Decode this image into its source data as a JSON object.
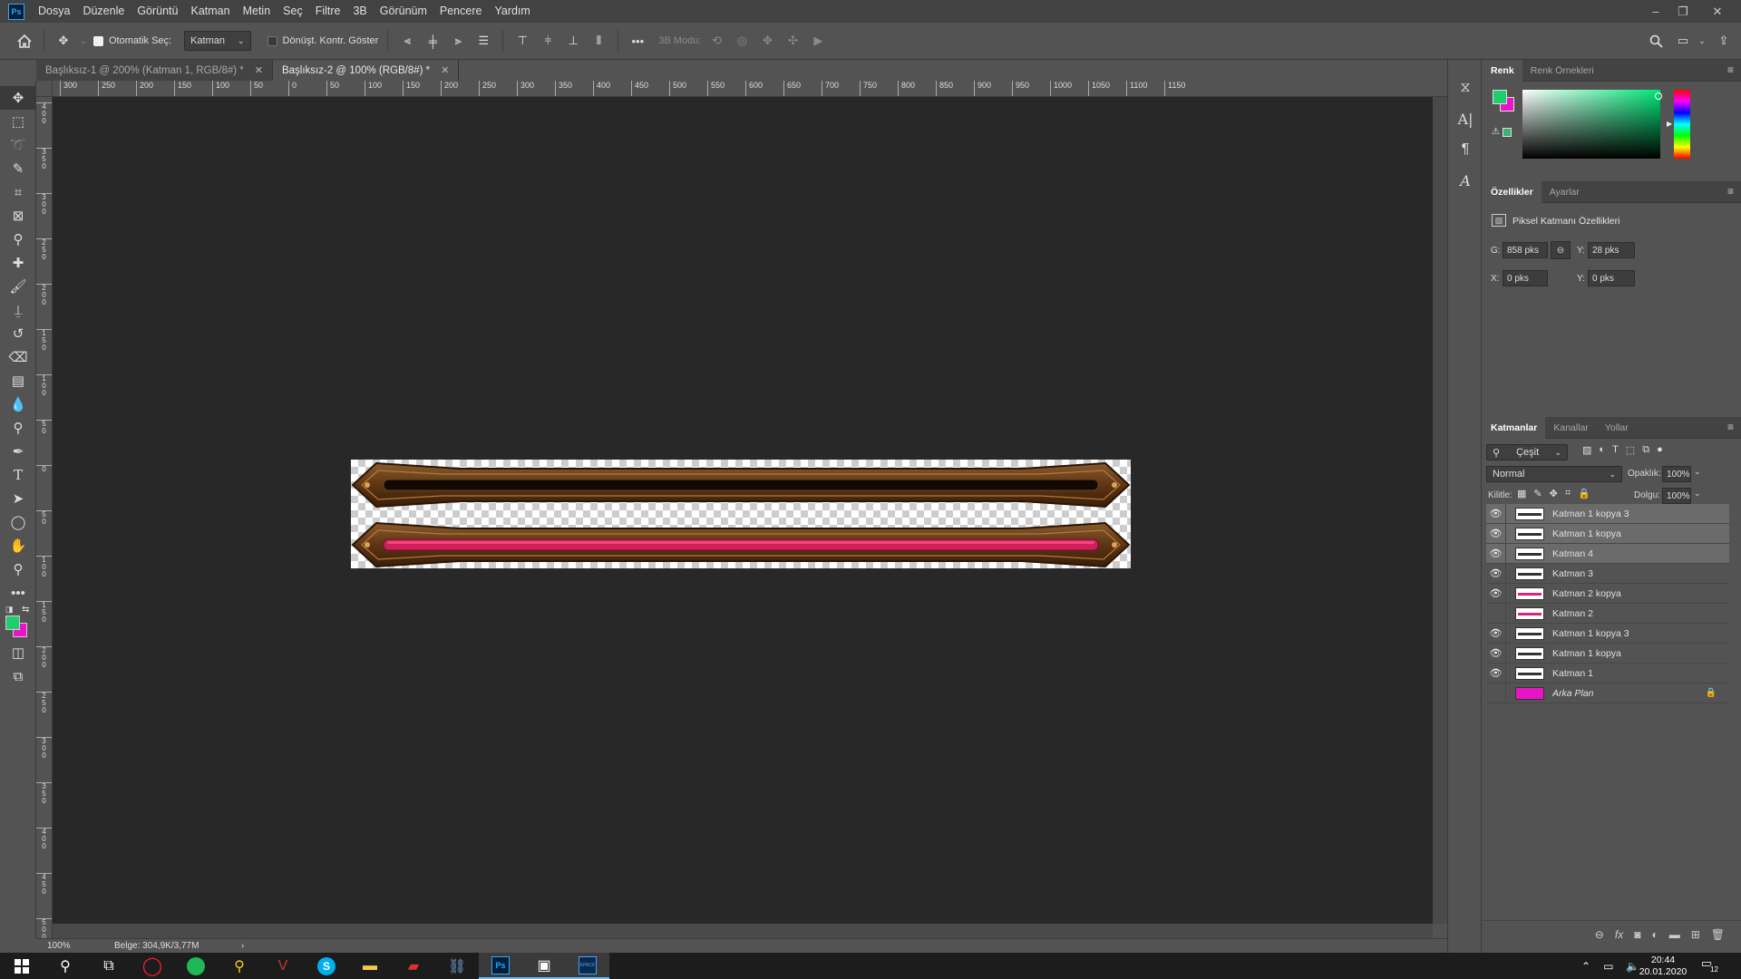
{
  "app": {
    "logo": "Ps"
  },
  "menu": [
    "Dosya",
    "Düzenle",
    "Görüntü",
    "Katman",
    "Metin",
    "Seç",
    "Filtre",
    "3B",
    "Görünüm",
    "Pencere",
    "Yardım"
  ],
  "options": {
    "auto_select_label": "Otomatik Seç:",
    "auto_select_value": "Katman",
    "transform_label": "Dönüşt. Kontr. Göster",
    "mode_3d_label": "3B Modu:"
  },
  "tabs": [
    {
      "label": "Başlıksız-1 @ 200% (Katman 1, RGB/8#) *",
      "active": false
    },
    {
      "label": "Başlıksız-2 @ 100% (RGB/8#) *",
      "active": true
    }
  ],
  "ruler_h": [
    "300",
    "250",
    "200",
    "150",
    "100",
    "50",
    "0",
    "50",
    "100",
    "150",
    "200",
    "250",
    "300",
    "350",
    "400",
    "450",
    "500",
    "550",
    "600",
    "650",
    "700",
    "750",
    "800",
    "850",
    "900",
    "950",
    "1000",
    "1050",
    "1100",
    "1150"
  ],
  "ruler_v": [
    "400",
    "350",
    "300",
    "250",
    "200",
    "150",
    "100",
    "50",
    "0",
    "50",
    "100",
    "150",
    "200",
    "250",
    "300",
    "350",
    "400",
    "450",
    "500"
  ],
  "status": {
    "zoom": "100%",
    "doc_size": "Belge: 304,9K/3,77M"
  },
  "color_panel": {
    "tabs": [
      "Renk",
      "Renk Örnekleri"
    ],
    "foreground": "#1fcf6f",
    "background": "#e815c8"
  },
  "properties_panel": {
    "tabs": [
      "Özellikler",
      "Ayarlar"
    ],
    "title": "Piksel Katmanı Özellikleri",
    "w_label": "G:",
    "w_value": "858 pks",
    "h_label": "Y:",
    "h_value": "28 pks",
    "x_label": "X:",
    "x_value": "0 pks",
    "y_label": "Y:",
    "y_value": "0 pks"
  },
  "layers_panel": {
    "tabs": [
      "Katmanlar",
      "Kanallar",
      "Yollar"
    ],
    "filter": "Çeşit",
    "blend_mode": "Normal",
    "opacity_label": "Opaklık:",
    "opacity_value": "100%",
    "lock_label": "Kilitle:",
    "fill_label": "Dolgu:",
    "fill_value": "100%",
    "layers": [
      {
        "name": "Katman 1 kopya 3",
        "visible": true,
        "selected": true,
        "thumb": "dark"
      },
      {
        "name": "Katman 1 kopya",
        "visible": true,
        "selected": true,
        "thumb": "dark"
      },
      {
        "name": "Katman 4",
        "visible": true,
        "selected": true,
        "thumb": "dark"
      },
      {
        "name": "Katman 3",
        "visible": true,
        "selected": false,
        "thumb": "dark"
      },
      {
        "name": "Katman 2 kopya",
        "visible": true,
        "selected": false,
        "thumb": "pink"
      },
      {
        "name": "Katman 2",
        "visible": false,
        "selected": false,
        "thumb": "pink"
      },
      {
        "name": "Katman 1 kopya 3",
        "visible": true,
        "selected": false,
        "thumb": "dark"
      },
      {
        "name": "Katman 1 kopya",
        "visible": true,
        "selected": false,
        "thumb": "dark"
      },
      {
        "name": "Katman 1",
        "visible": true,
        "selected": false,
        "thumb": "dark"
      },
      {
        "name": "Arka Plan",
        "visible": false,
        "selected": false,
        "thumb": "magenta",
        "locked": true
      }
    ]
  },
  "taskbar": {
    "time": "20:44",
    "date": "20.01.2020",
    "notifications": "12",
    "epack_label": "EPACK"
  }
}
